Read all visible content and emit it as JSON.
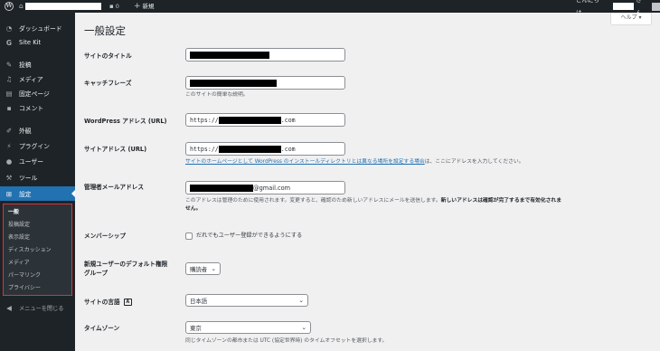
{
  "admin_bar": {
    "comment_count": "0",
    "new_label": "新規",
    "greeting_prefix": "こんにちは、",
    "greeting_suffix": "さん"
  },
  "sidebar": {
    "items": [
      {
        "label": "ダッシュボード",
        "icon": "dashboard-icon"
      },
      {
        "label": "Site Kit",
        "icon": "site-kit-icon"
      },
      {
        "label": "投稿",
        "icon": "pin-icon"
      },
      {
        "label": "メディア",
        "icon": "media-icon"
      },
      {
        "label": "固定ページ",
        "icon": "page-icon"
      },
      {
        "label": "コメント",
        "icon": "comment-icon"
      },
      {
        "label": "外観",
        "icon": "appearance-icon"
      },
      {
        "label": "プラグイン",
        "icon": "plugin-icon"
      },
      {
        "label": "ユーザー",
        "icon": "user-icon"
      },
      {
        "label": "ツール",
        "icon": "wrench-icon"
      },
      {
        "label": "設定",
        "icon": "settings-icon"
      }
    ],
    "submenu": [
      "一般",
      "投稿設定",
      "表示設定",
      "ディスカッション",
      "メディア",
      "パーマリンク",
      "プライバシー"
    ],
    "collapse_label": "メニューを閉じる"
  },
  "help_label": "ヘルプ ▾",
  "page_title": "一般設定",
  "fields": {
    "site_title": {
      "label": "サイトのタイトル"
    },
    "tagline": {
      "label": "キャッチフレーズ",
      "description": "このサイトの簡単な説明。"
    },
    "wp_address": {
      "label": "WordPress アドレス (URL)",
      "prefix": "https://",
      "suffix": ".com"
    },
    "site_address": {
      "label": "サイトアドレス (URL)",
      "prefix": "https://",
      "suffix": ".com",
      "link_text": "サイトのホームページとして WordPress のインストールディレクトリとは異なる場所を設定する場合",
      "desc_rest": "は、ここにアドレスを入力してください。"
    },
    "admin_email": {
      "label": "管理者メールアドレス",
      "suffix": "@gmail.com",
      "description_1": "このアドレスは管理のために使用されます。変更すると、確認のため新しいアドレスにメールを送信します。",
      "description_bold": "新しいアドレスは確認が完了するまで有効化されま",
      "description_2": "せん。"
    },
    "membership": {
      "label": "メンバーシップ",
      "checkbox_label": "だれでもユーザー登録ができるようにする"
    },
    "default_role": {
      "label_1": "新規ユーザーのデフォルト権限",
      "label_2": "グループ",
      "value": "購読者"
    },
    "site_language": {
      "label": "サイトの言語",
      "value": "日本語"
    },
    "timezone": {
      "label": "タイムゾーン",
      "value": "東京",
      "description": "同じタイムゾーンの都市または UTC (協定世界時) のタイムオフセットを選択します。"
    }
  },
  "colors": {
    "admin_bar": "#1d2327",
    "accent": "#2271b1",
    "highlight_border": "#d63638",
    "background": "#f0f0f1"
  }
}
